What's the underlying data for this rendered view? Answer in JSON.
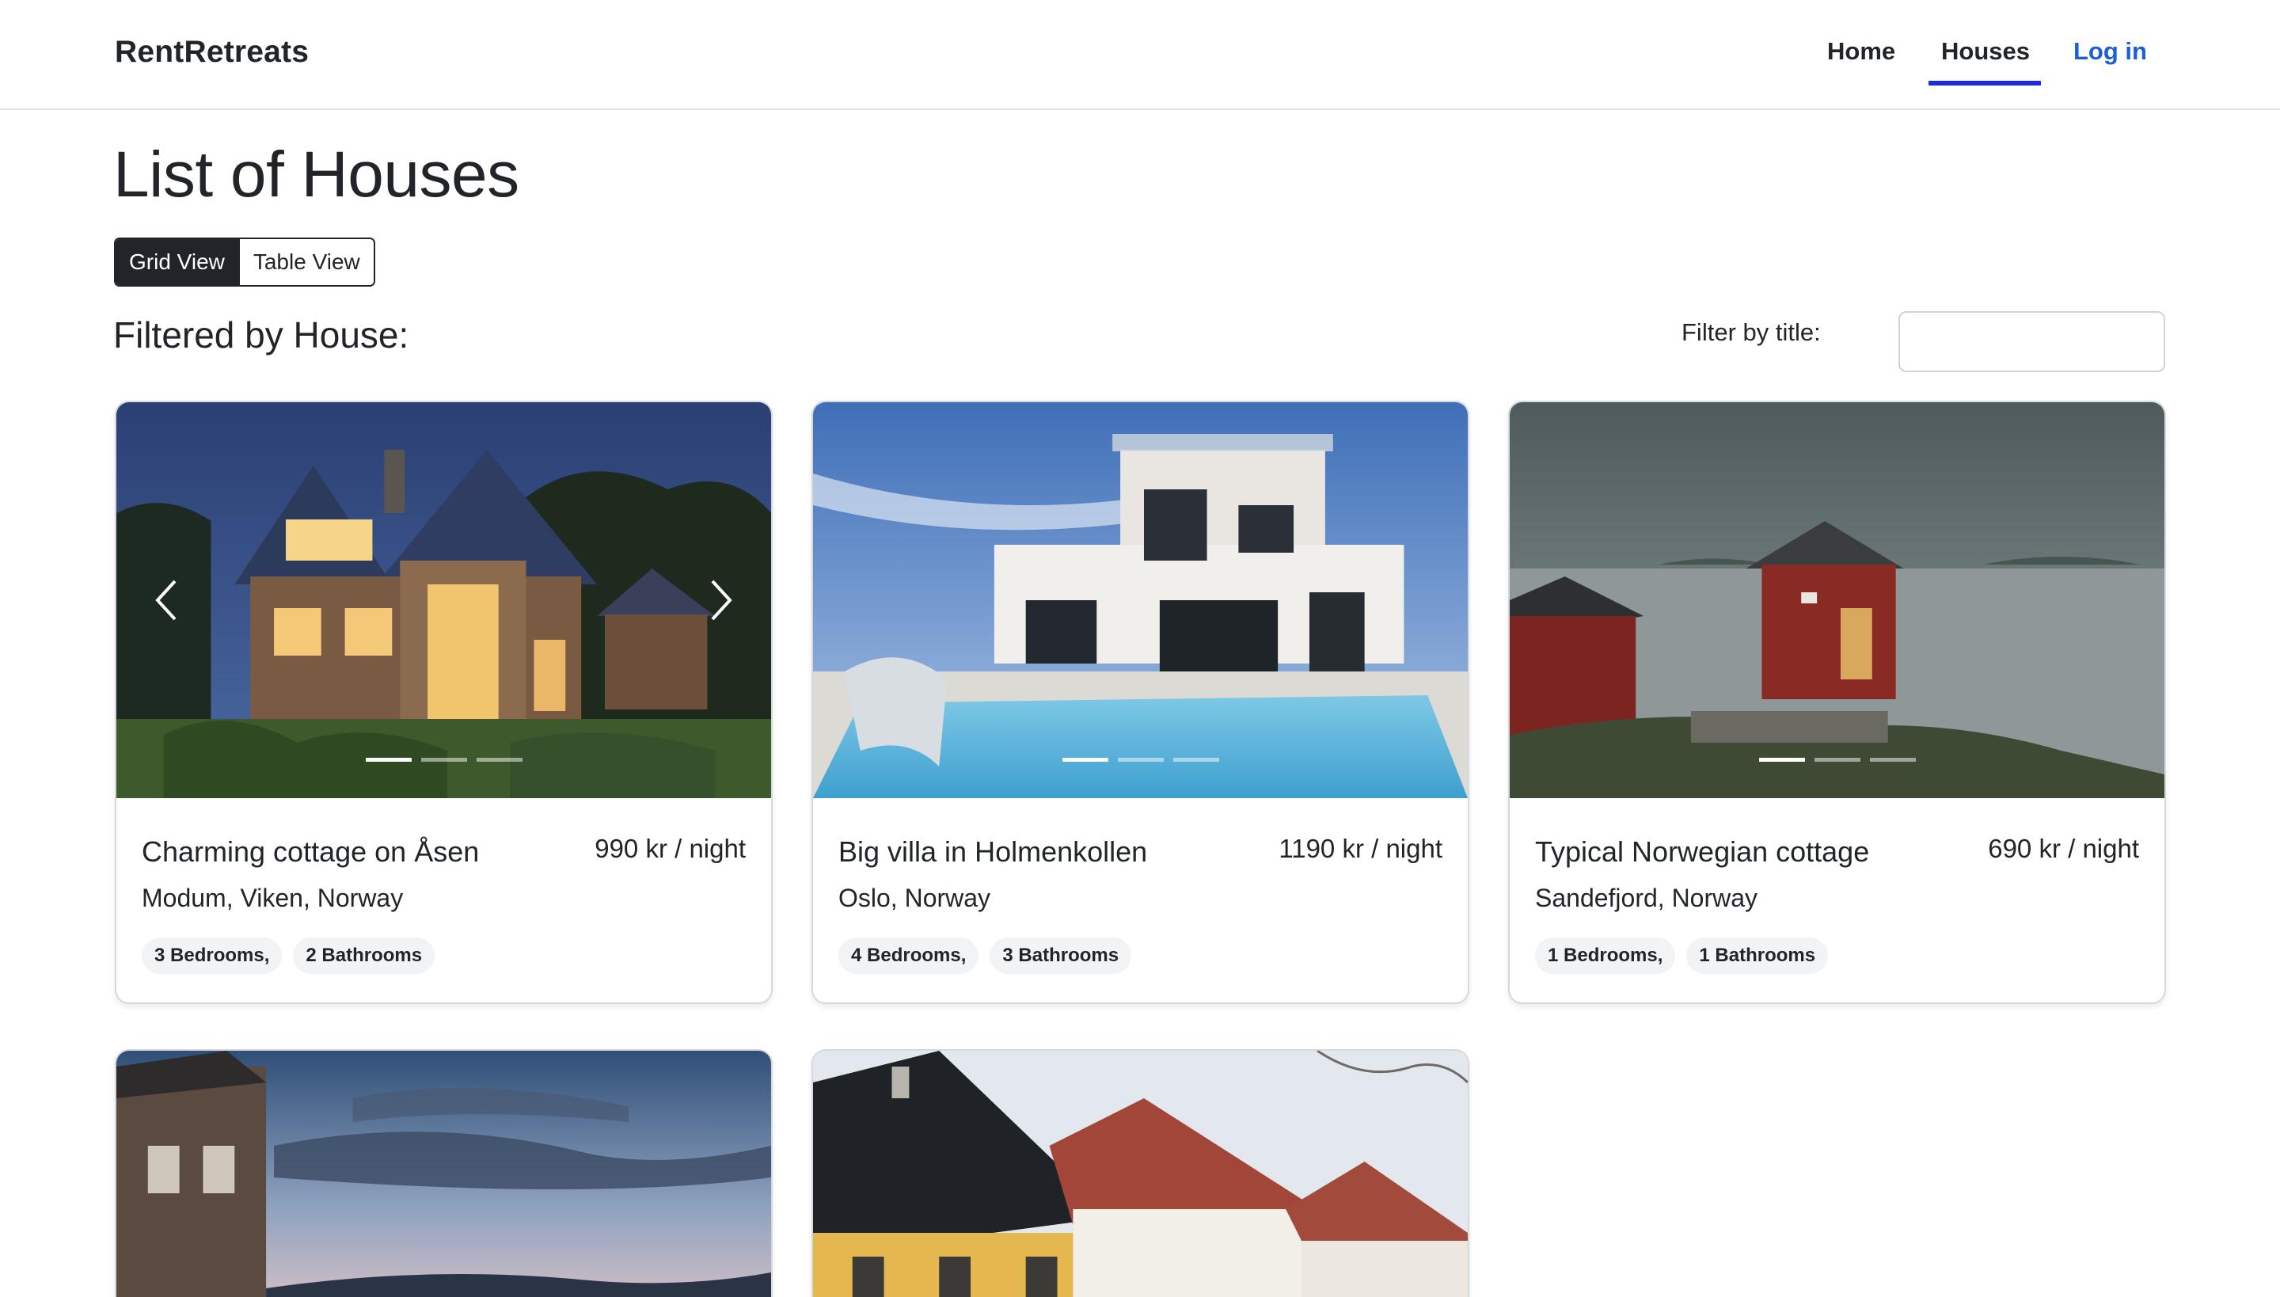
{
  "app": {
    "brand": "RentRetreats"
  },
  "nav": {
    "home": "Home",
    "houses": "Houses",
    "login": "Log in"
  },
  "page": {
    "title": "List of Houses",
    "grid_view_label": "Grid View",
    "table_view_label": "Table View",
    "filtered_label": "Filtered by House:",
    "filter_label": "Filter by title:",
    "filter_value": "",
    "filter_placeholder": ""
  },
  "houses": [
    {
      "title": "Charming cottage on Åsen",
      "price": "990 kr / night",
      "location": "Modum, Viken, Norway",
      "bedrooms": "3 Bedrooms,",
      "bathrooms": "2 Bathrooms",
      "image": "cottage-evening-image"
    },
    {
      "title": "Big villa in Holmenkollen",
      "price": "1190 kr / night",
      "location": "Oslo, Norway",
      "bedrooms": "4 Bedrooms,",
      "bathrooms": "3 Bathrooms",
      "image": "modern-villa-pool-image"
    },
    {
      "title": "Typical Norwegian cottage",
      "price": "690 kr / night",
      "location": "Sandefjord, Norway",
      "bedrooms": "1 Bedrooms,",
      "bathrooms": "1 Bathrooms",
      "image": "red-cottage-fjord-image"
    },
    {
      "image": "fjord-dusk-image"
    },
    {
      "image": "townhouse-row-image"
    }
  ],
  "carousel": {
    "prev_icon": "chevron-left-icon",
    "next_icon": "chevron-right-icon"
  },
  "colors": {
    "accent": "#1a5fd6",
    "nav_underline": "#1f2bd8",
    "dark": "#212529"
  }
}
